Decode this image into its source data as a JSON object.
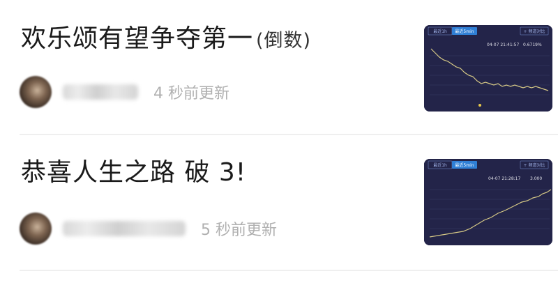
{
  "feed": [
    {
      "title": "欢乐颂有望争夺第一",
      "title_suffix": "(倒数)",
      "time_ago": "4 秒前更新",
      "chart": {
        "tab_left": "最近1h",
        "tab_active": "最近5min",
        "tab_right": "+ 频道对比",
        "timestamp": "04-07 21:41:57",
        "stat": "0.6719%"
      }
    },
    {
      "title": "恭喜人生之路 破 3!",
      "title_suffix": "",
      "time_ago": "5 秒前更新",
      "chart": {
        "tab_left": "最近1h",
        "tab_active": "最近5min",
        "tab_right": "+ 频道对比",
        "timestamp": "04-07 21:28:17",
        "stat": "3.000"
      }
    }
  ],
  "colors": {
    "chart_bg": "#232449",
    "chart_line": "#d6c986",
    "tab_active": "#2f7fd6",
    "timeago": "#b0b0b0"
  }
}
